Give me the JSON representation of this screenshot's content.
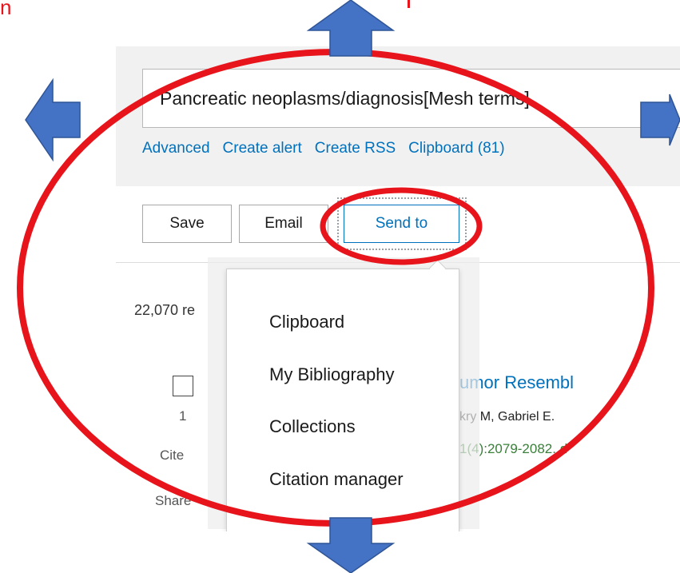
{
  "fragments": {
    "left_glyph": "n"
  },
  "search": {
    "query": "Pancreatic neoplasms/diagnosis[Mesh terms]",
    "links": [
      "Advanced",
      "Create alert",
      "Create RSS",
      "Clipboard (81)"
    ]
  },
  "toolbar": {
    "save_label": "Save",
    "email_label": "Email",
    "send_to_label": "Send to"
  },
  "results": {
    "count_text": "22,070 re",
    "row_number": "1",
    "cite_label": "Cite",
    "share_label": "Share",
    "title_fragment": "umor Resembl",
    "authors_fragment": "kry M, Gabriel E.",
    "journal_fragment": "1(4):2079-2082. d"
  },
  "send_to_menu": {
    "items": [
      "Clipboard",
      "My Bibliography",
      "Collections",
      "Citation manager"
    ]
  },
  "colors": {
    "accent": "#0071bc",
    "annotation": "#e8141b",
    "arrow": "#4472c4",
    "journal": "#3a7f3a"
  }
}
